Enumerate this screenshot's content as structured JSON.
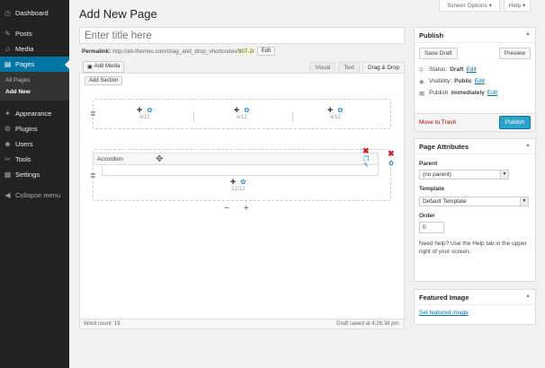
{
  "sidebar": {
    "items": [
      {
        "icon": "dashboard-icon",
        "glyph": "◷",
        "label": "Dashboard"
      },
      {
        "icon": "pushpin-icon",
        "glyph": "✎",
        "label": "Posts"
      },
      {
        "icon": "media-icon",
        "glyph": "♫",
        "label": "Media"
      },
      {
        "icon": "pages-icon",
        "glyph": "▤",
        "label": "Pages"
      }
    ],
    "submenu": [
      "All Pages",
      "Add New"
    ],
    "items2": [
      {
        "icon": "appearance-icon",
        "glyph": "✦",
        "label": "Appearance"
      },
      {
        "icon": "plugins-icon",
        "glyph": "⚙",
        "label": "Plugins"
      },
      {
        "icon": "users-icon",
        "glyph": "☻",
        "label": "Users"
      },
      {
        "icon": "tools-icon",
        "glyph": "✂",
        "label": "Tools"
      },
      {
        "icon": "settings-icon",
        "glyph": "▦",
        "label": "Settings"
      }
    ],
    "collapse": "Collapse menu"
  },
  "top": {
    "screen_options": "Screen Options ▾",
    "help": "Help ▾"
  },
  "page_title": "Add New Page",
  "title_placeholder": "Enter title here",
  "permalink": {
    "label": "Permalink:",
    "url": "http://ab-themes.com/drag_and_drop_shortcodes/",
    "slug": "907-2/",
    "edit": "Edit"
  },
  "add_media": "Add Media",
  "tabs": [
    "Visual",
    "Text",
    "Drag & Drop"
  ],
  "add_section": "Add Section",
  "row1_cols": [
    "4/12",
    "4/12",
    "4/12"
  ],
  "accordion_label": "Accordion",
  "row2_col": "12/12",
  "word_count": "Word count: 19",
  "draft_saved": "Draft saved at 4:26:38 pm.",
  "publish": {
    "title": "Publish",
    "save_draft": "Save Draft",
    "preview": "Preview",
    "status_label": "Status:",
    "status_value": "Draft",
    "visibility_label": "Visibility:",
    "visibility_value": "Public",
    "publish_label": "Publish",
    "publish_value": "immediately",
    "edit": "Edit",
    "trash": "Move to Trash",
    "publish_btn": "Publish"
  },
  "attributes": {
    "title": "Page Attributes",
    "parent_label": "Parent",
    "parent_value": "(no parent)",
    "template_label": "Template",
    "template_value": "Default Template",
    "order_label": "Order",
    "order_value": "0",
    "help": "Need help? Use the Help tab in the upper right of your screen."
  },
  "featured": {
    "title": "Featured Image",
    "link": "Set featured image"
  }
}
